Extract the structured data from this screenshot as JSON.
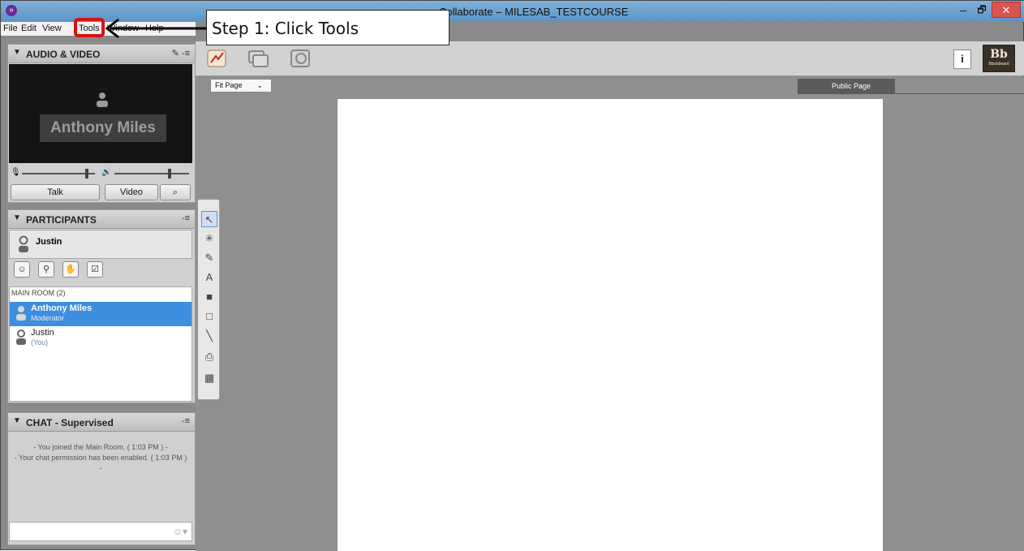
{
  "window": {
    "title": "Collaborate – MILESAB_TESTCOURSE",
    "minimize": "–",
    "maximize": "🗗",
    "close": "✕"
  },
  "menu": [
    "File",
    "Edit",
    "View",
    "Tools",
    "Window",
    "Help"
  ],
  "callout": {
    "text": "Step 1: Click Tools",
    "highlight_color": "#dd1111"
  },
  "audio_video": {
    "title": "AUDIO & VIDEO",
    "speaker_name": "Anthony Miles",
    "talk_label": "Talk",
    "video_label": "Video"
  },
  "participants": {
    "title": "PARTICIPANTS",
    "self_name": "Justin",
    "room_label": "MAIN ROOM (2)",
    "list": [
      {
        "name": "Anthony Miles",
        "role": "Moderator",
        "selected": true
      },
      {
        "name": "Justin",
        "role": "(You)",
        "selected": false
      }
    ]
  },
  "chat": {
    "title": "CHAT - Supervised",
    "messages": [
      "- You joined the Main Room. ( 1:03 PM ) -",
      "- Your chat permission has been enabled. ( 1:03 PM ) -"
    ]
  },
  "whiteboard": {
    "zoom_label": "Fit Page",
    "page_tab": "Public Page"
  },
  "toolbar": {
    "info_label": "i",
    "logo_text": "Bb",
    "logo_sub": "Blackboard"
  },
  "colors": {
    "selected_row": "#3d8ede",
    "titlebar": "#6a9fcf"
  }
}
